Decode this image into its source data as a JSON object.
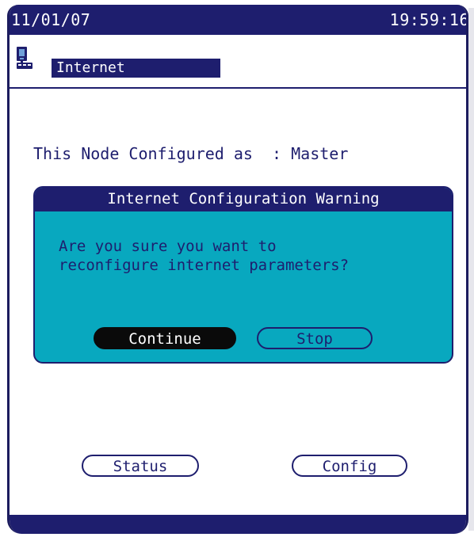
{
  "header": {
    "date": "11/01/07",
    "time": "19:59:16"
  },
  "title": {
    "label": "Internet",
    "icon": "network-node-icon"
  },
  "node_status": {
    "text": "This Node Configured as  : Master"
  },
  "dialog": {
    "title": "Internet Configuration Warning",
    "message": "Are you sure you want to\nreconfigure internet parameters?",
    "continue_label": "Continue",
    "stop_label": "Stop"
  },
  "footer_buttons": {
    "status_label": "Status",
    "config_label": "Config"
  },
  "colors": {
    "navy": "#1e1e6e",
    "dialog_bg": "#08a8bf",
    "active_button": "#0a0a0a"
  }
}
